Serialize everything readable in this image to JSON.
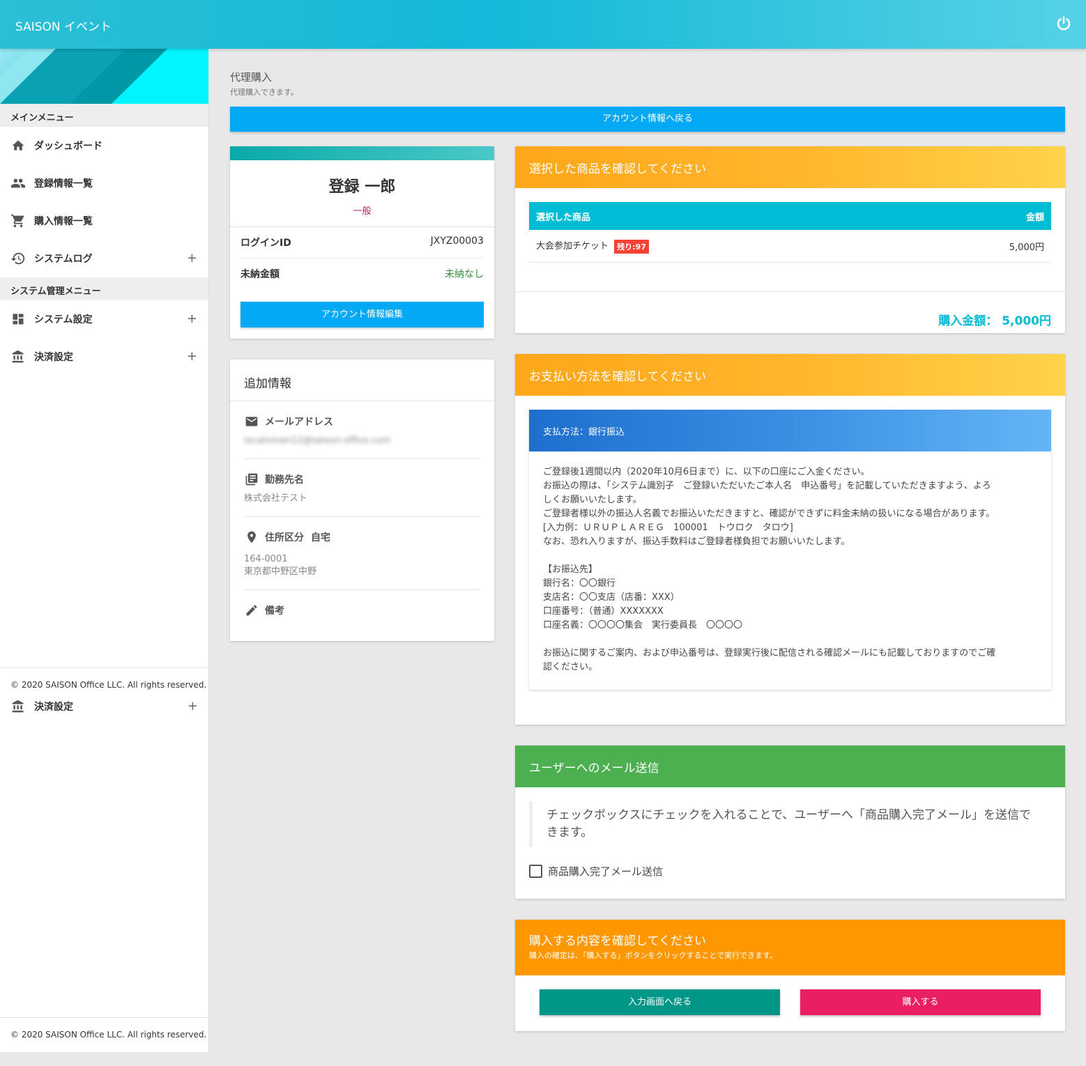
{
  "header": {
    "app_title": "SAISON イベント"
  },
  "sidebar": {
    "main_menu_label": "メインメニュー",
    "main_items": [
      {
        "label": "ダッシュボード",
        "icon": "home-icon",
        "expandable": false
      },
      {
        "label": "登録情報一覧",
        "icon": "people-icon",
        "expandable": false
      },
      {
        "label": "購入情報一覧",
        "icon": "cart-icon",
        "expandable": false
      },
      {
        "label": "システムログ",
        "icon": "history-icon",
        "expandable": true
      }
    ],
    "admin_menu_label": "システム管理メニュー",
    "admin_items": [
      {
        "label": "システム設定",
        "icon": "dashboard-icon",
        "expandable": true
      },
      {
        "label": "決済設定",
        "icon": "bank-icon",
        "expandable": true
      }
    ],
    "copyright": "© 2020 SAISON Office LLC. All rights reserved.",
    "duplicate_item": {
      "label": "決済設定",
      "icon": "bank-icon"
    },
    "copyright_bottom": "© 2020 SAISON Office LLC. All rights reserved."
  },
  "page": {
    "title": "代理購入",
    "subtitle": "代理購入できます。",
    "back_button": "アカウント情報へ戻る"
  },
  "profile": {
    "name": "登録 一郎",
    "role": "一般",
    "rows": [
      {
        "key": "ログインID",
        "value": "JXYZ00003"
      },
      {
        "key": "未納金額",
        "value": "未納なし"
      }
    ],
    "edit_button": "アカウント情報編集"
  },
  "extra": {
    "title": "追加情報",
    "email_label": "メールアドレス",
    "email_value": "localnman12@saison-office.com",
    "company_label": "勤務先名",
    "company_value": "株式会社テスト",
    "address_label": "住所区分",
    "address_type": "自宅",
    "postal": "164-0001",
    "address": "東京都中野区中野",
    "note_label": "備考"
  },
  "product": {
    "title": "選択した商品を確認してください",
    "col_item": "選択した商品",
    "col_amount": "金額",
    "item_name": "大会参加チケット",
    "badge": "残り:97",
    "item_price": "5,000円",
    "total": "購入金額： 5,000円"
  },
  "payment": {
    "title": "お支払い方法を確認してください",
    "method": "支払方法：銀行振込",
    "lines": [
      "ご登録後1週間以内（2020年10月6日まで）に、以下の口座にご入金ください。",
      "お振込の際は、「システム識別子　ご登録いただいたご本人名　申込番号」を記載していただきますよう、よろ",
      "しくお願いいたします。",
      "ご登録者様以外の振込人名義でお振込いただきますと、確認ができずに料金未納の扱いになる場合があります。",
      "[入力例：ＵＲＵＰＬＡＲＥＧ　100001　トウロク　タロウ]",
      "なお、恐れ入りますが、振込手数料はご登録者様負担でお願いいたします。",
      "",
      "【お振込先】",
      "銀行名：〇〇銀行",
      "支店名：〇〇支店（店番：XXX）",
      "口座番号：（普通）XXXXXXX",
      "口座名義：〇〇〇〇集会　実行委員長　〇〇〇〇",
      "",
      "お振込に関するご案内、および申込番号は、登録実行後に配信される確認メールにも記載しておりますのでご確",
      "認ください。"
    ]
  },
  "mail": {
    "title": "ユーザーへのメール送信",
    "description": "チェックボックスにチェックを入れることで、ユーザーへ「商品購入完了メール」を送信できます。",
    "checkbox_label": "商品購入完了メール送信",
    "checked": false
  },
  "confirm": {
    "title": "購入する内容を確認してください",
    "subtitle": "購入の確定は、「購入する」ボタンをクリックすることで実行できます。",
    "back_button": "入力画面へ戻る",
    "buy_button": "購入する"
  },
  "colors": {
    "accent_blue": "#03a9f4",
    "cyan": "#00bcd4",
    "orange": "#ff9800",
    "green": "#4caf50",
    "teal": "#009688",
    "pink": "#e91e63",
    "badge_red": "#f44336"
  }
}
